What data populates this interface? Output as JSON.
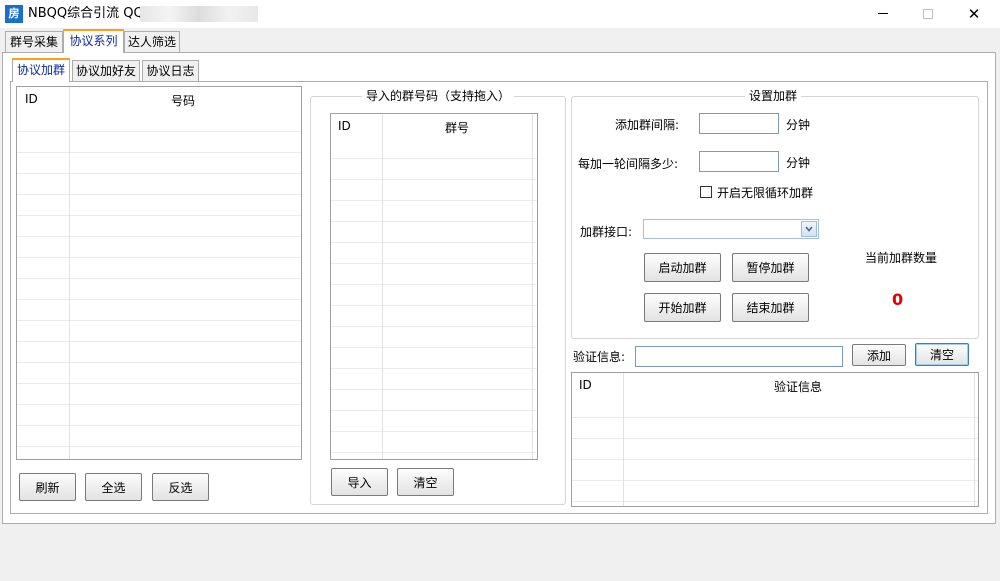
{
  "window": {
    "title": "NBQQ综合引流 QQ",
    "icon_text": "房",
    "controls": {
      "minimize": "minimize-icon",
      "maximize": "maximize-icon",
      "close": "close-icon",
      "close_glyph": "✕"
    }
  },
  "main_tabs": [
    "群号采集",
    "协议系列",
    "达人筛选"
  ],
  "sub_tabs": [
    "协议加群",
    "协议加好友",
    "协议日志"
  ],
  "left_grid": {
    "col_id": "ID",
    "col_number": "号码"
  },
  "left_buttons": {
    "refresh": "刷新",
    "select_all": "全选",
    "invert": "反选"
  },
  "import_box": {
    "title": "导入的群号码（支持拖入）",
    "col_id": "ID",
    "col_group": "群号",
    "import_btn": "导入",
    "clear_btn": "清空"
  },
  "settings": {
    "title": "设置加群",
    "interval_label": "添加群间隔:",
    "interval_value": "",
    "interval_unit": "分钟",
    "round_label": "每加一轮间隔多少:",
    "round_value": "",
    "round_unit": "分钟",
    "loop_label": "开启无限循环加群",
    "loop_checked": false,
    "api_label": "加群接口:",
    "api_value": "",
    "buttons": {
      "launch": "启动加群",
      "pause": "暂停加群",
      "start": "开始加群",
      "stop": "结束加群"
    },
    "count_label": "当前加群数量",
    "count_value": "0",
    "count_color": "#e00000"
  },
  "verify": {
    "label": "验证信息:",
    "value": "",
    "add_btn": "添加",
    "clear_btn": "清空",
    "col_id": "ID",
    "col_info": "验证信息"
  }
}
